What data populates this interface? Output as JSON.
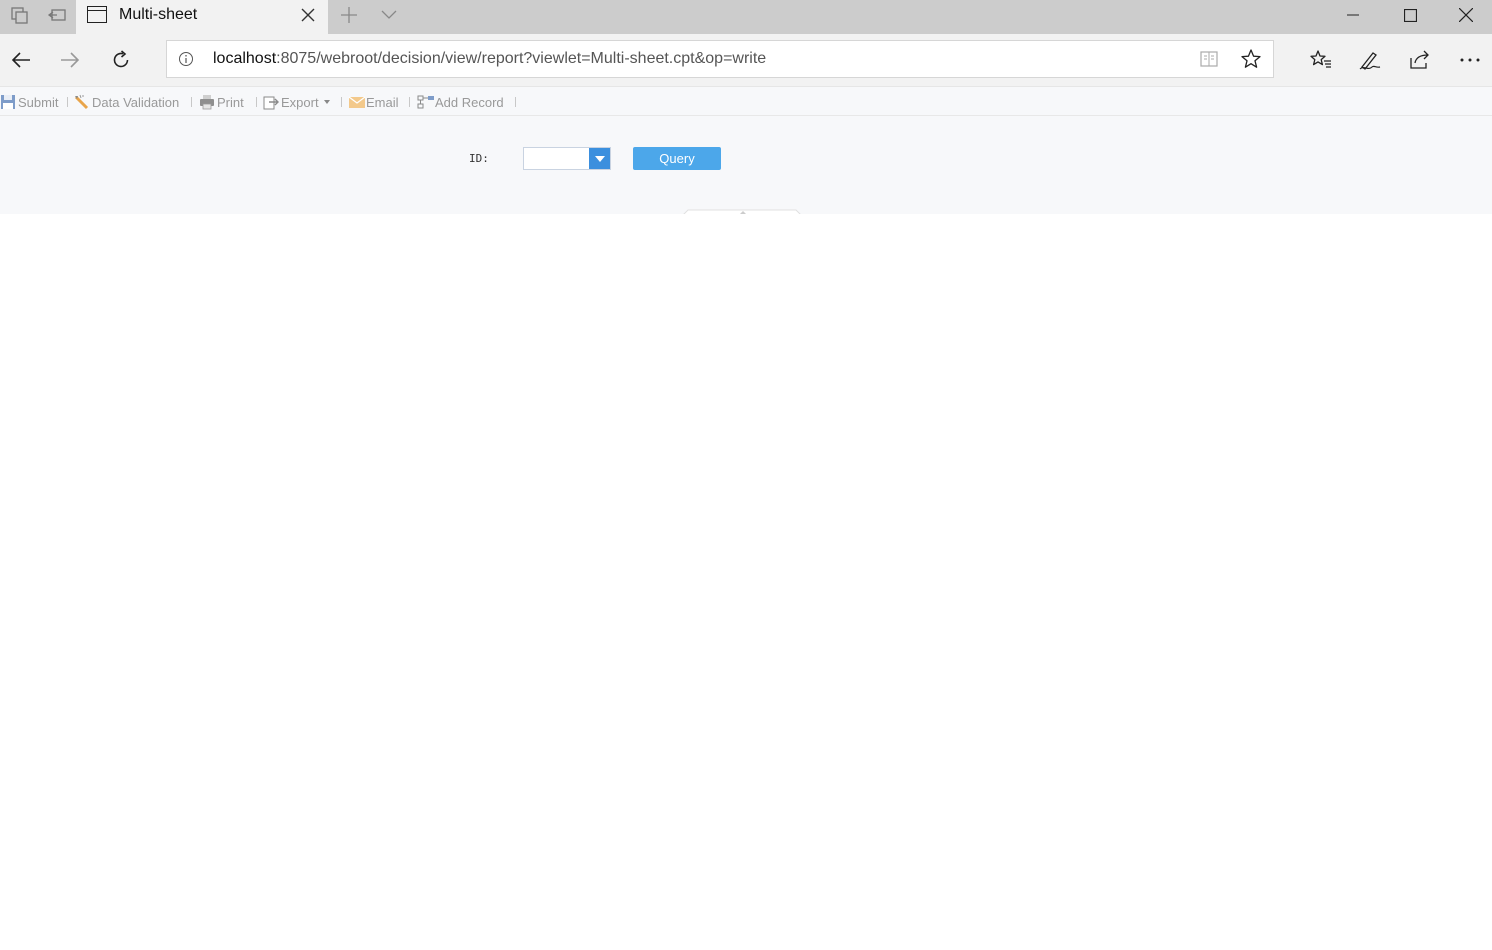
{
  "browser": {
    "tab": {
      "title": "Multi-sheet"
    },
    "address_bar": {
      "host": "localhost",
      "rest": ":8075/webroot/decision/view/report?viewlet=Multi-sheet.cpt&op=write"
    }
  },
  "report_toolbar": {
    "items": [
      {
        "label": "Submit",
        "icon": "save-icon"
      },
      {
        "label": "Data Validation",
        "icon": "validate-icon"
      },
      {
        "label": "Print",
        "icon": "printer-icon"
      },
      {
        "label": "Export",
        "icon": "export-icon",
        "has_dropdown": true
      },
      {
        "label": "Email",
        "icon": "envelope-icon"
      },
      {
        "label": "Add Record",
        "icon": "add-record-icon"
      }
    ]
  },
  "parameter_panel": {
    "id_label": "ID:",
    "id_value": "",
    "query_label": "Query"
  },
  "colors": {
    "titlebar": "#cccccc",
    "toolbar_text": "#999999",
    "query_button": "#4ca7ea",
    "combo_button": "#3b8fde",
    "panel_bg": "#f7f8fa"
  }
}
